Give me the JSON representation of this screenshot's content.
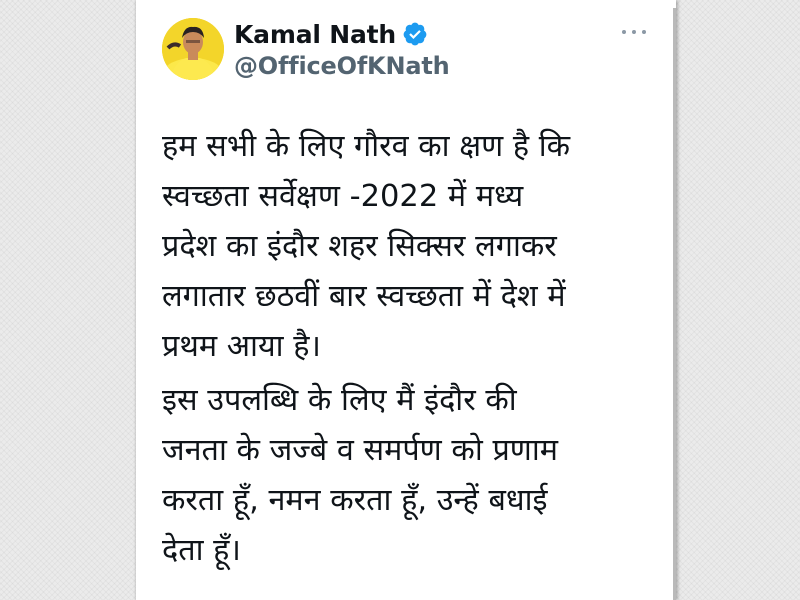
{
  "tweet": {
    "author": {
      "display_name": "Kamal Nath",
      "handle": "@OfficeOfKNath",
      "verified": true,
      "avatar_icon": "profile-photo"
    },
    "more_icon": "more-options-icon",
    "paragraphs": [
      {
        "lines": [
          "हम सभी के लिए गौरव का क्षण है कि",
          "स्वच्छता सर्वेक्षण -2022 में मध्य",
          "प्रदेश का इंदौर शहर सिक्सर लगाकर",
          "लगातार छठवीं बार स्वच्छता में देश में",
          "प्रथम आया है।"
        ]
      },
      {
        "lines": [
          "इस उपलब्धि के लिए मैं इंदौर की",
          "जनता के जज्बे व समर्पण को प्रणाम",
          "करता हूँ, नमन करता हूँ, उन्हें बधाई",
          "देता हूँ।"
        ]
      }
    ]
  },
  "colors": {
    "verified_badge": "#1d9bf0",
    "name_text": "#0f1419",
    "handle_text": "#536471",
    "card_background": "#ffffff",
    "page_background": "#ebebeb"
  }
}
